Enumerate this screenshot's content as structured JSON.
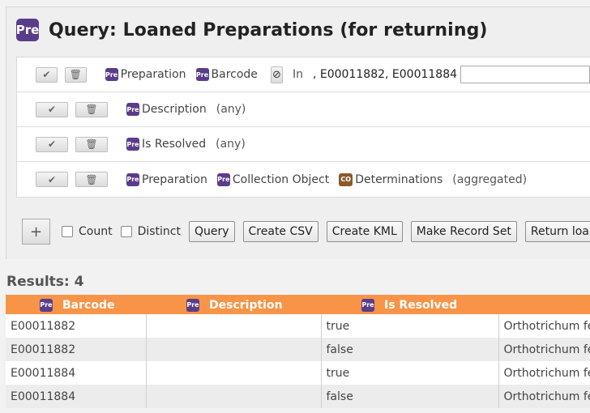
{
  "header": {
    "icon_label": "Pre",
    "title": "Query: Loaned Preparations (for returning)"
  },
  "query_lines": [
    {
      "fields": [
        {
          "icon": "Pre",
          "label": "Preparation"
        },
        {
          "icon": "Pre",
          "label": "Barcode"
        }
      ],
      "negate_symbol": "⊘",
      "operator": "In",
      "value": ", E00011882, E00011884",
      "input_value": ""
    },
    {
      "fields": [
        {
          "icon": "Pre",
          "label": "Description"
        }
      ],
      "modifier": "(any)"
    },
    {
      "fields": [
        {
          "icon": "Pre",
          "label": "Is Resolved"
        }
      ],
      "modifier": "(any)"
    },
    {
      "fields": [
        {
          "icon": "Pre",
          "label": "Preparation"
        },
        {
          "icon": "Pre",
          "label": "Collection Object"
        },
        {
          "icon": "CO",
          "label": "Determinations"
        }
      ],
      "modifier": "(aggregated)"
    }
  ],
  "toolbar": {
    "add_label": "+",
    "count_label": "Count",
    "distinct_label": "Distinct",
    "query_label": "Query",
    "create_csv_label": "Create CSV",
    "create_kml_label": "Create KML",
    "make_record_set_label": "Make Record Set",
    "return_label": "Return loa"
  },
  "results": {
    "label": "Results: 4",
    "columns": [
      {
        "icon": "Pre",
        "label": "Barcode"
      },
      {
        "icon": "Pre",
        "label": "Description"
      },
      {
        "icon": "Pre",
        "label": "Is Resolved"
      },
      {
        "icon": "",
        "label": ""
      }
    ],
    "rows": [
      [
        "E00011882",
        "",
        "true",
        "Orthotrichum fe"
      ],
      [
        "E00011882",
        "",
        "false",
        "Orthotrichum fe"
      ],
      [
        "E00011884",
        "",
        "true",
        "Orthotrichum fe"
      ],
      [
        "E00011884",
        "",
        "false",
        "Orthotrichum fe"
      ]
    ]
  },
  "colors": {
    "accent": "#f79447",
    "table_icon": "#5a3d8a",
    "co_icon": "#8a5a28"
  }
}
